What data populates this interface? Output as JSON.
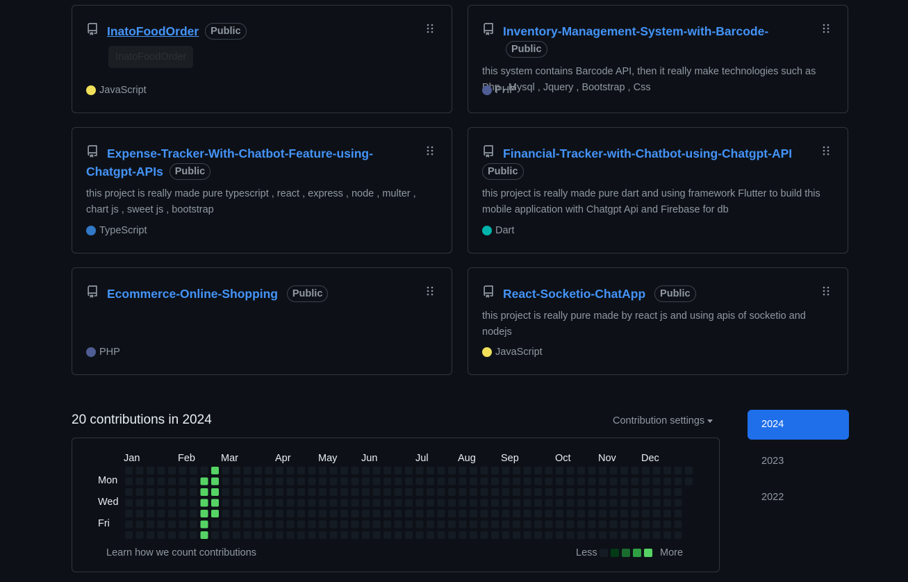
{
  "colors": {
    "background": "#0d1117",
    "link": "#4493f8",
    "muted": "#9198a1",
    "border": "#30363d",
    "active_year": "#1f6feb",
    "contrib_levels": [
      "#151b23",
      "#033a16",
      "#196c2e",
      "#2ea043",
      "#56d364"
    ]
  },
  "repos": [
    {
      "name": "InatoFoodOrder",
      "visibility": "Public",
      "description": "",
      "button_label": "InatoFoodOrder",
      "language": "JavaScript",
      "language_color": "#f1e05a",
      "icon": "repo-icon"
    },
    {
      "name": "Inventory-Management-System-with-Barcode-",
      "visibility": "Public",
      "description": "this system contains Barcode API, then it really make technologies such as Php , Mysql , Jquery , Bootstrap , Css",
      "language": "PHP",
      "language_color": "#4F5D95",
      "icon": "repo-icon"
    },
    {
      "name": "Expense-Tracker-With-Chatbot-Feature-using-Chatgpt-APIs",
      "visibility": "Public",
      "description": "this project is really made pure typescript , react , express , node , multer , chart js , sweet js , bootstrap",
      "language": "TypeScript",
      "language_color": "#3178c6",
      "icon": "repo-icon"
    },
    {
      "name": "Financial-Tracker-with-Chatbot-using-Chatgpt-API",
      "visibility": "Public",
      "description": "this project is really made pure dart and using framework Flutter to build this mobile application with Chatgpt Api and Firebase for db",
      "language": "Dart",
      "language_color": "#00B4AB",
      "icon": "repo-icon"
    },
    {
      "name": "Ecommerce-Online-Shopping",
      "visibility": "Public",
      "description": "",
      "language": "PHP",
      "language_color": "#4F5D95",
      "icon": "repo-icon"
    },
    {
      "name": "React-Socketio-ChatApp",
      "visibility": "Public",
      "description": "this project is really pure made by react js and using apis of socketio and nodejs",
      "language": "JavaScript",
      "language_color": "#f1e05a",
      "icon": "repo-icon"
    }
  ],
  "contributions": {
    "heading": "20 contributions in 2024",
    "settings_label": "Contribution settings",
    "months": [
      "Jan",
      "Feb",
      "Mar",
      "Apr",
      "May",
      "Jun",
      "Jul",
      "Aug",
      "Sep",
      "Oct",
      "Nov",
      "Dec"
    ],
    "day_labels": [
      "Mon",
      "Wed",
      "Fri"
    ],
    "learn_link": "Learn how we count contributions",
    "legend_less": "Less",
    "legend_more": "More",
    "weeks": 53,
    "active_days": [
      {
        "week": 7,
        "day": 1,
        "level": 4
      },
      {
        "week": 7,
        "day": 2,
        "level": 4
      },
      {
        "week": 7,
        "day": 3,
        "level": 4
      },
      {
        "week": 7,
        "day": 4,
        "level": 4
      },
      {
        "week": 7,
        "day": 5,
        "level": 4
      },
      {
        "week": 7,
        "day": 6,
        "level": 4
      },
      {
        "week": 8,
        "day": 0,
        "level": 4
      },
      {
        "week": 8,
        "day": 1,
        "level": 4
      },
      {
        "week": 8,
        "day": 2,
        "level": 4
      },
      {
        "week": 8,
        "day": 3,
        "level": 4
      },
      {
        "week": 8,
        "day": 4,
        "level": 4
      }
    ]
  },
  "years": [
    "2024",
    "2023",
    "2022"
  ],
  "selected_year": "2024"
}
